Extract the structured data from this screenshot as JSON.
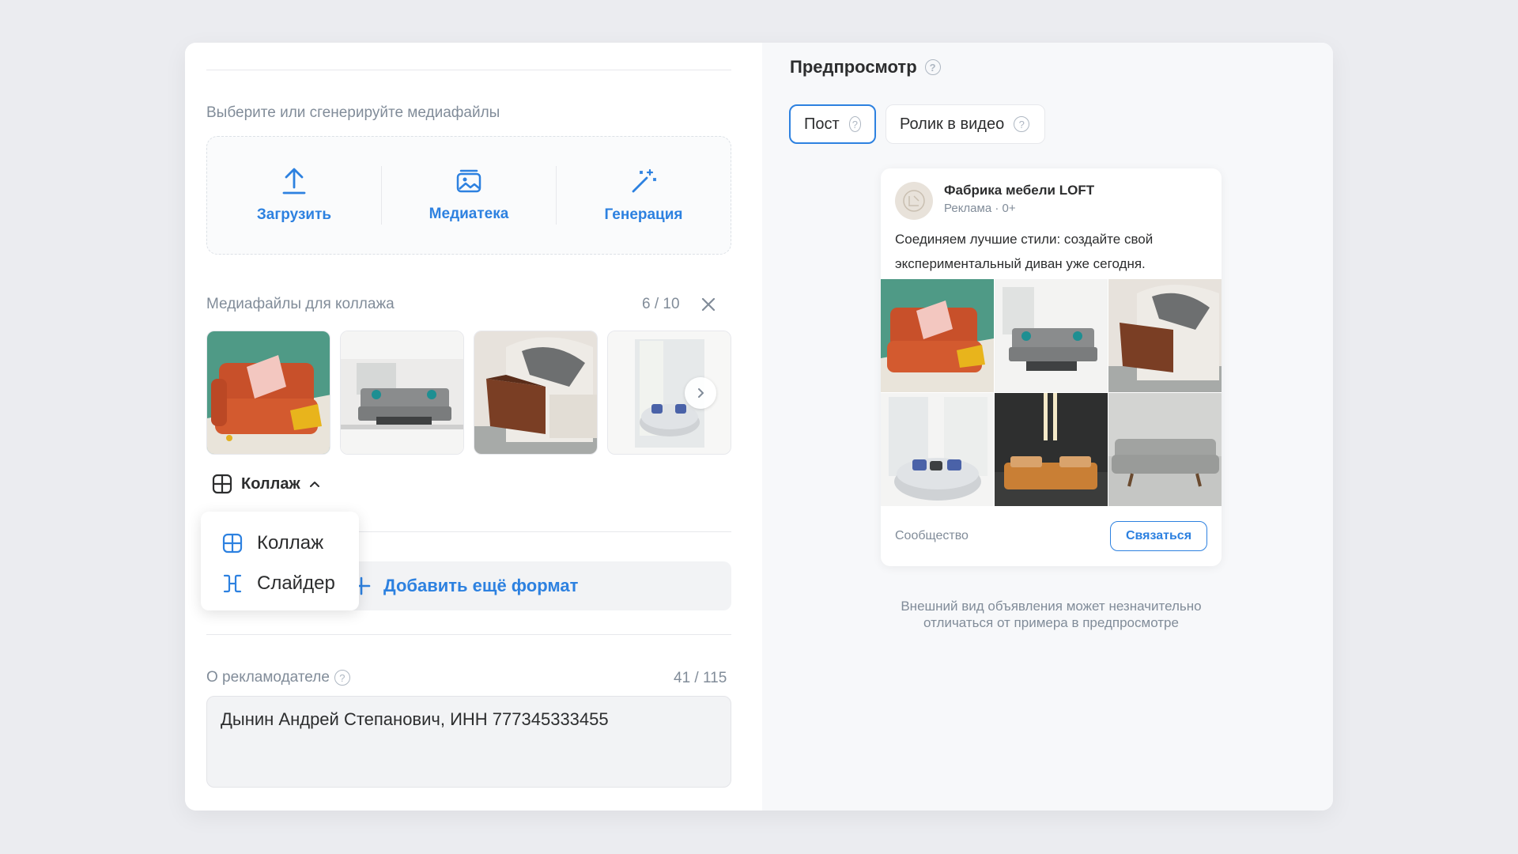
{
  "left": {
    "media_select_label": "Выберите или сгенерируйте медиафайлы",
    "media_buttons": [
      {
        "label": "Загрузить",
        "icon": "upload-icon"
      },
      {
        "label": "Медиатека",
        "icon": "image-library-icon"
      },
      {
        "label": "Генерация",
        "icon": "magic-wand-icon"
      }
    ],
    "collage_files_label": "Медиафайлы для коллажа",
    "collage_count": "6 / 10",
    "thumbnails": [
      "orange-sofa",
      "grey-sofa-room",
      "sofa-wooden-armrest",
      "round-chair"
    ],
    "format_selected": "Коллаж",
    "format_options": [
      {
        "label": "Коллаж",
        "icon": "collage-icon"
      },
      {
        "label": "Слайдер",
        "icon": "slider-icon"
      }
    ],
    "add_format_label": "Добавить ещё формат",
    "advertiser_label": "О рекламодателе",
    "advertiser_count": "41 / 115",
    "advertiser_value": "Дынин Андрей Степанович, ИНН 777345333455"
  },
  "preview": {
    "title": "Предпросмотр",
    "tabs": [
      {
        "label": "Пост",
        "active": true
      },
      {
        "label": "Ролик в видео",
        "active": false
      }
    ],
    "post": {
      "author": "Фабрика мебели LOFT",
      "meta": "Реклама · 0+",
      "text": "Соединяем лучшие стили: создайте свой экспериментальный диван уже сегодня.",
      "footer_label": "Сообщество",
      "button_label": "Связаться"
    },
    "disclaimer": "Внешний вид объявления может незначительно отличаться от примера в предпросмотре"
  },
  "colors": {
    "accent": "#2d81e0",
    "muted": "#818c99",
    "background": "#ebecf0"
  }
}
